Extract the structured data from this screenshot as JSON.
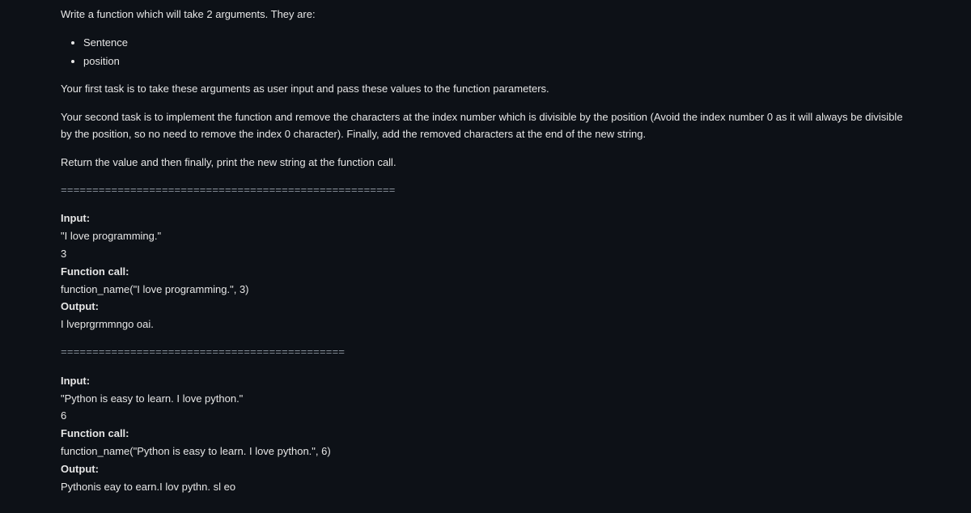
{
  "intro": "Write a function which will take 2 arguments. They are:",
  "args": {
    "item1": "Sentence",
    "item2": "position"
  },
  "task1": "Your first task is to take these arguments as user input and pass these values to the function parameters.",
  "task2": "Your second task is to implement the function and remove the characters at the index number which is divisible by the position (Avoid the index number 0 as it will always be divisible by the position, so no need to remove the index 0 character). Finally, add the removed characters at the end of the new string.",
  "task3": "Return the value and then finally, print the new string at the function call.",
  "separator1": "=====================================================",
  "example1": {
    "inputLabel": "Input:",
    "inputLine1": "\"I love programming.\"",
    "inputLine2": "3",
    "callLabel": "Function call:",
    "callLine": "function_name(\"I love programming.\", 3)",
    "outputLabel": "Output:",
    "outputLine": "I lveprgrmmngo oai."
  },
  "separator2": "=============================================",
  "example2": {
    "inputLabel": "Input:",
    "inputLine1": "\"Python is easy to learn. I love python.\"",
    "inputLine2": "6",
    "callLabel": "Function call:",
    "callLine": "function_name(\"Python is easy to learn. I love python.\", 6)",
    "outputLabel": "Output:",
    "outputLine": "Pythonis eay to earn.I lov pythn. sl  eo"
  }
}
